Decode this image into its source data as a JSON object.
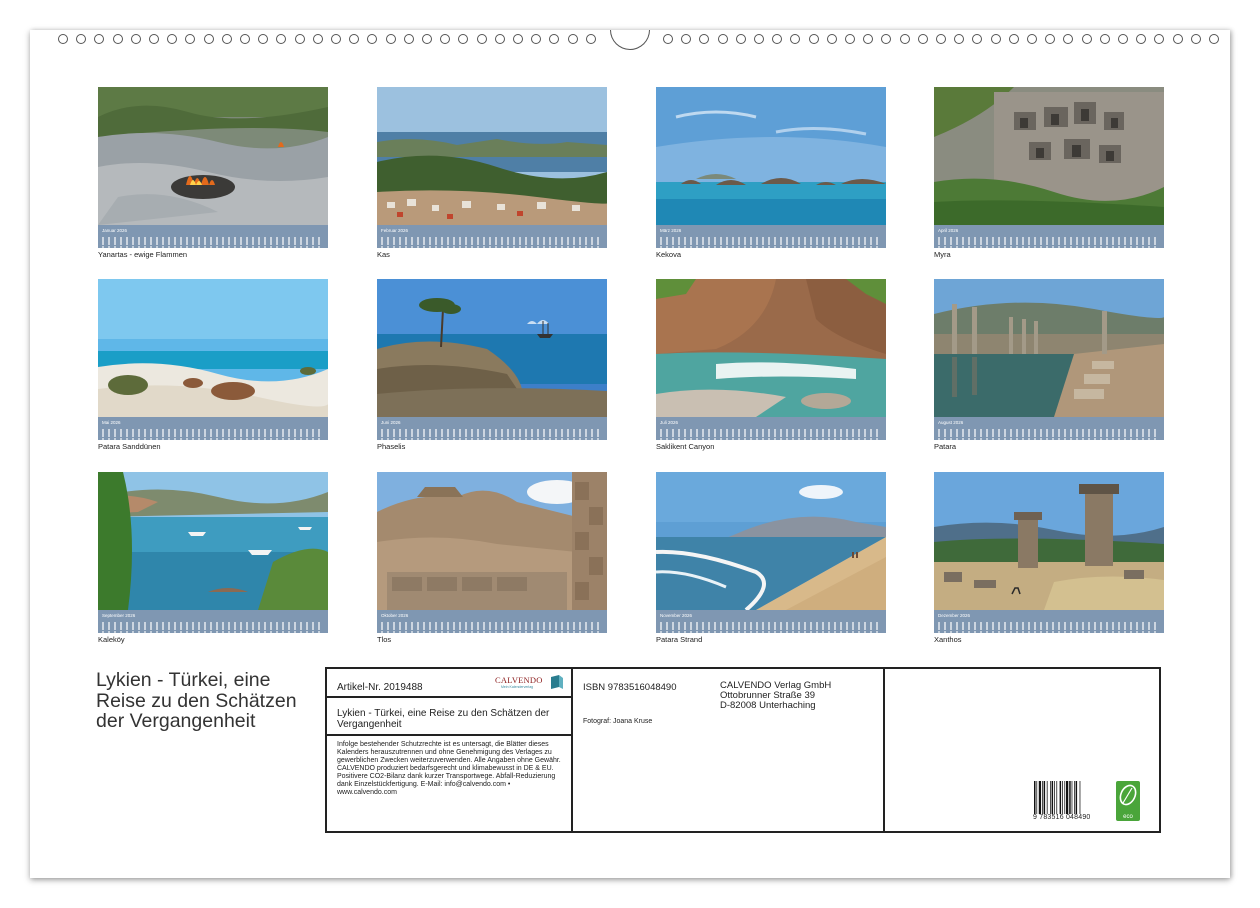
{
  "binding": {
    "left_rings": 30,
    "right_rings": 31
  },
  "months": [
    {
      "month_label": "Januar 2026",
      "caption": "Yanartas - ewige Flammen",
      "scene": "rocks-flames"
    },
    {
      "month_label": "Februar 2026",
      "caption": "Kas",
      "scene": "bay-town"
    },
    {
      "month_label": "März 2026",
      "caption": "Kekova",
      "scene": "sea-islands"
    },
    {
      "month_label": "April 2026",
      "caption": "Myra",
      "scene": "rock-tombs"
    },
    {
      "month_label": "Mai 2026",
      "caption": "Patara Sanddünen",
      "scene": "dunes"
    },
    {
      "month_label": "Juni 2026",
      "caption": "Phaselis",
      "scene": "tree-ship"
    },
    {
      "month_label": "Juli 2026",
      "caption": "Saklikent Canyon",
      "scene": "canyon"
    },
    {
      "month_label": "August 2026",
      "caption": "Patara",
      "scene": "columns-pool"
    },
    {
      "month_label": "September 2026",
      "caption": "Kaleköy",
      "scene": "harbor"
    },
    {
      "month_label": "Oktober 2026",
      "caption": "Tlos",
      "scene": "fortress"
    },
    {
      "month_label": "November 2026",
      "caption": "Patara Strand",
      "scene": "beach"
    },
    {
      "month_label": "Dezember 2026",
      "caption": "Xanthos",
      "scene": "pillar-tombs"
    }
  ],
  "cover": {
    "title": "Lykien - Türkei, eine Reise zu den Schätzen der Vergangenheit"
  },
  "info": {
    "artikel": "Artikel-Nr. 2019488",
    "logo_brand": "CALVENDO",
    "logo_tagline": "Mein Kalenderverlag",
    "book_title": "Lykien - Türkei, eine Reise zu den Schätzen der Vergangenheit",
    "legal": "Infolge bestehender Schutzrechte ist es untersagt, die Blätter dieses Kalenders herauszutrennen und ohne Genehmigung des Verlages zu gewerblichen Zwecken weiterzuverwenden. Alle Angaben ohne Gewähr. CALVENDO produziert bedarfsgerecht und klimabewusst in DE & EU. Positivere CO2-Bilanz dank kurzer Transportwege. Abfall-Reduzierung dank Einzelstückfertigung. E-Mail: info@calvendo.com • www.calvendo.com",
    "isbn": "ISBN 9783516048490",
    "photographer": "Fotograf: Joana Kruse",
    "publisher_line1": "CALVENDO Verlag GmbH",
    "publisher_line2": "Ottobrunner Straße 39",
    "publisher_line3": "D-82008 Unterhaching",
    "barcode_number": "9 783516 048490",
    "eco_label": "eco"
  },
  "colors": {
    "calendar_bar": "#7f97b2",
    "eco_green": "#4aa53a",
    "brand_red": "#8b1c1c"
  }
}
